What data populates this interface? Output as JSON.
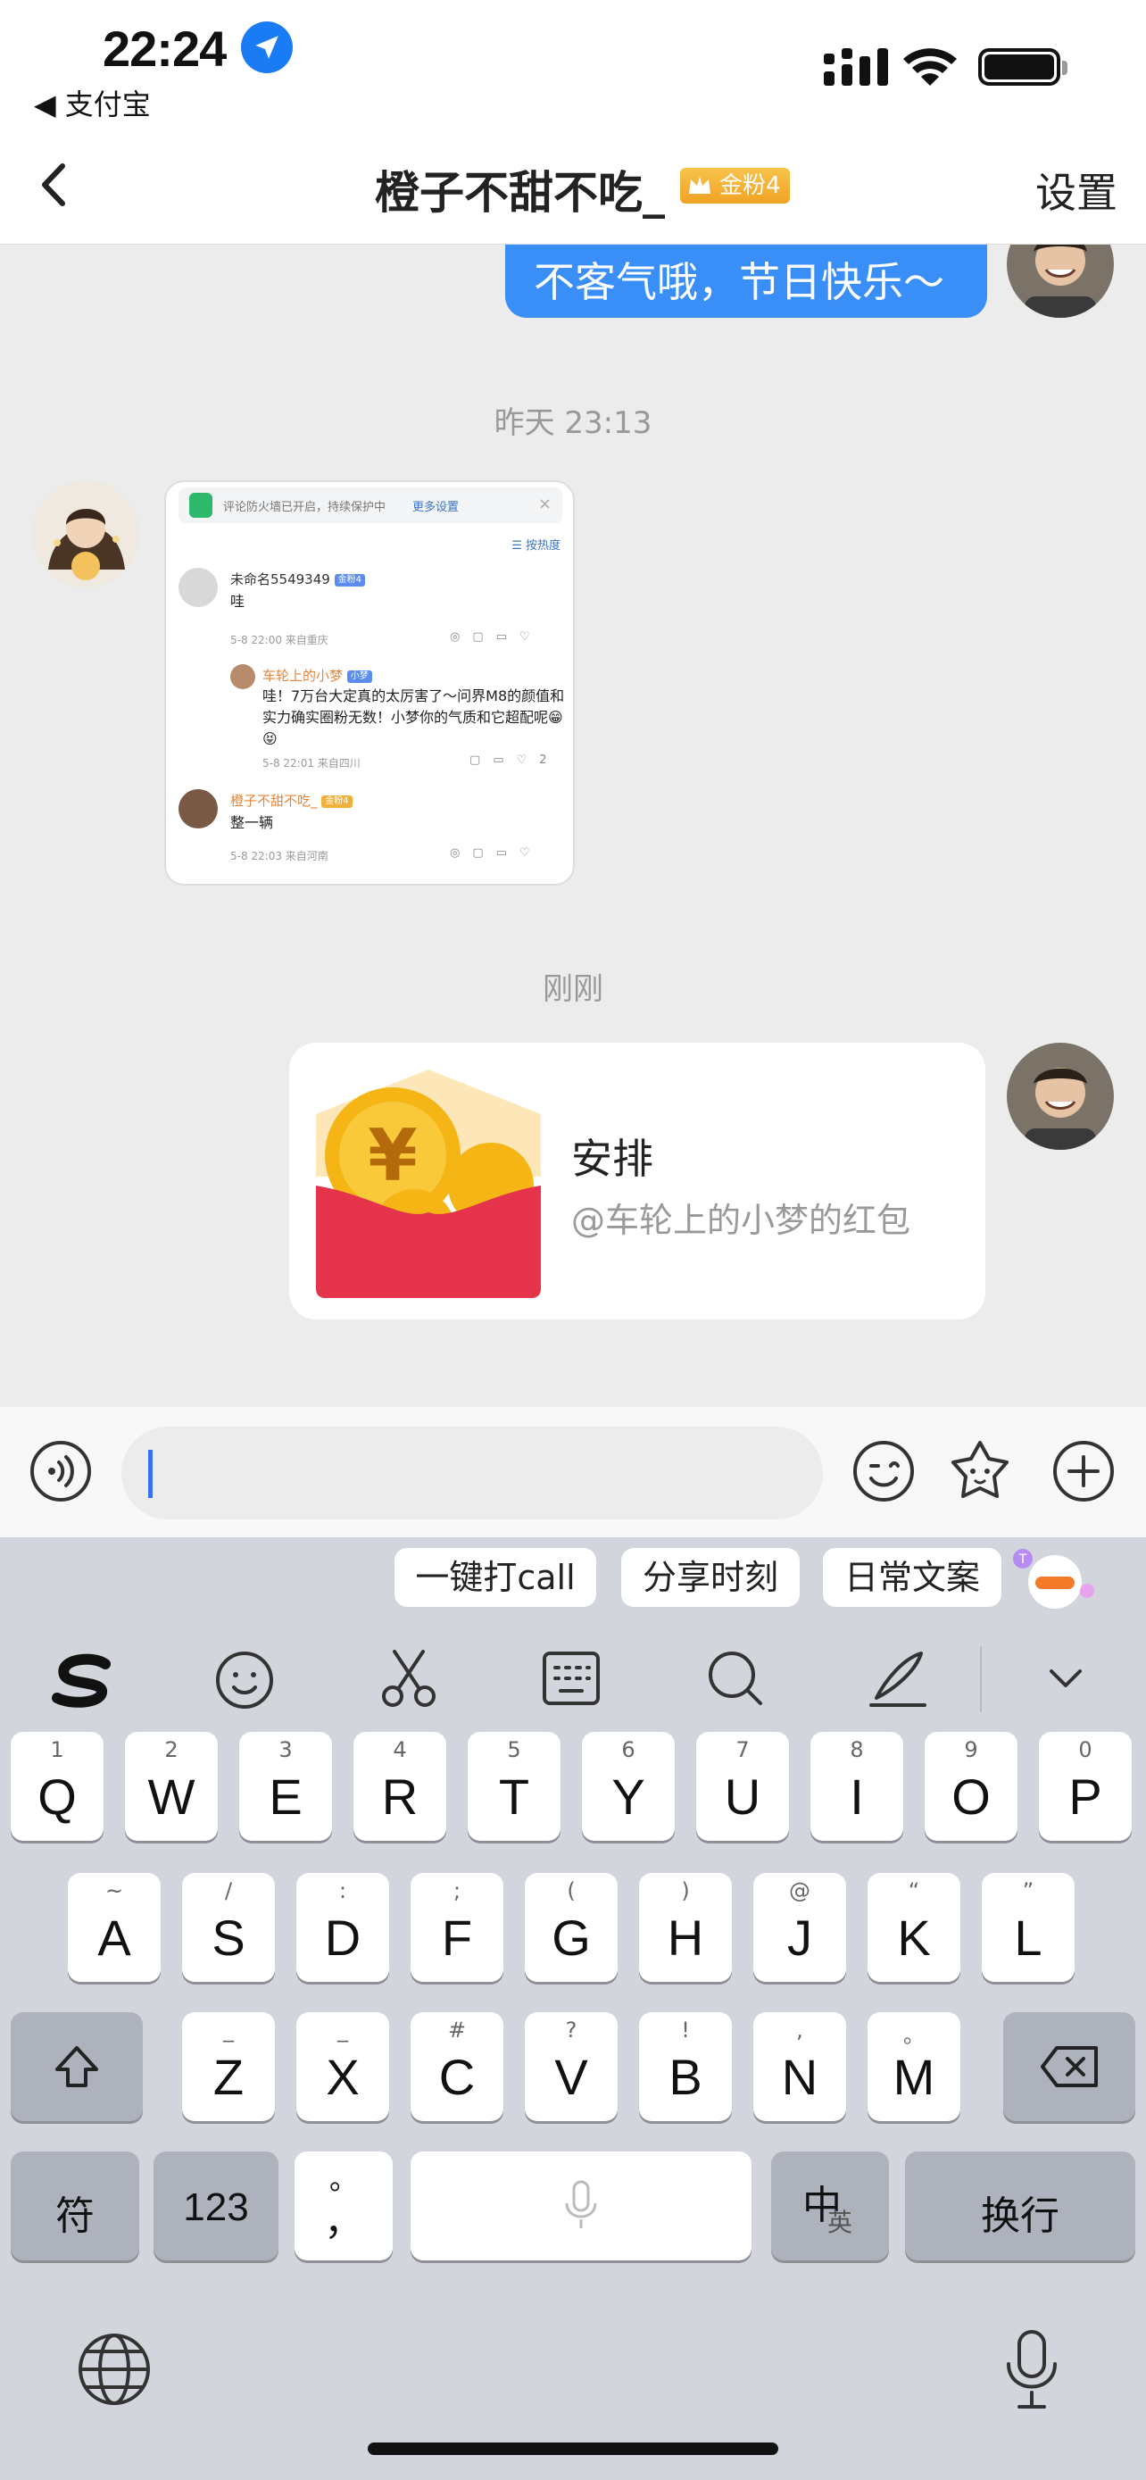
{
  "status_bar": {
    "time": "22:24",
    "back_app": "◀ 支付宝"
  },
  "nav": {
    "title": "橙子不甜不吃_",
    "badge": "金粉4",
    "settings": "设置"
  },
  "chat": {
    "prev_message": "不客气哦，节日快乐～",
    "timestamp_1": "昨天 23:13",
    "timestamp_2": "刚刚",
    "screenshot": {
      "banner_text": "评论防火墙已开启，持续保护中",
      "banner_more": "更多设置",
      "sort_label": "按热度",
      "c1_name": "未命名5549349",
      "c1_badge": "金粉4",
      "c1_text": "哇",
      "c1_meta": "5-8 22:00 来自重庆",
      "c2_name": "车轮上的小梦",
      "c2_badge": "小梦",
      "c2_text": "哇！7万台大定真的太厉害了～问界M8的颜值和实力确实圈粉无数！小梦你的气质和它超配呢😁😝",
      "c2_meta": "5-8 22:01 来自四川",
      "c2_likes": "2",
      "c3_name": "橙子不甜不吃_",
      "c3_badge": "金粉4",
      "c3_text": "整一辆",
      "c3_meta": "5-8 22:03 来自河南"
    },
    "red_packet": {
      "label": "安排",
      "sub": "@车轮上的小梦的红包"
    }
  },
  "keyboard": {
    "chips": [
      "一键打call",
      "分享时刻",
      "日常文案"
    ],
    "row1": [
      {
        "k": "Q",
        "h": "1"
      },
      {
        "k": "W",
        "h": "2"
      },
      {
        "k": "E",
        "h": "3"
      },
      {
        "k": "R",
        "h": "4"
      },
      {
        "k": "T",
        "h": "5"
      },
      {
        "k": "Y",
        "h": "6"
      },
      {
        "k": "U",
        "h": "7"
      },
      {
        "k": "I",
        "h": "8"
      },
      {
        "k": "O",
        "h": "9"
      },
      {
        "k": "P",
        "h": "0"
      }
    ],
    "row2": [
      {
        "k": "A",
        "h": "~"
      },
      {
        "k": "S",
        "h": "/"
      },
      {
        "k": "D",
        "h": ":"
      },
      {
        "k": "F",
        "h": ";"
      },
      {
        "k": "G",
        "h": "("
      },
      {
        "k": "H",
        "h": ")"
      },
      {
        "k": "J",
        "h": "@"
      },
      {
        "k": "K",
        "h": "“"
      },
      {
        "k": "L",
        "h": "”"
      }
    ],
    "row3": [
      {
        "k": "Z",
        "h": "_"
      },
      {
        "k": "X",
        "h": "_"
      },
      {
        "k": "C",
        "h": "#"
      },
      {
        "k": "V",
        "h": "?"
      },
      {
        "k": "B",
        "h": "!"
      },
      {
        "k": "N",
        "h": ","
      },
      {
        "k": "M",
        "h": "。"
      }
    ],
    "symbols_key": "符",
    "numbers_key": "123",
    "punct_key_top": "。",
    "punct_key_bottom": "，",
    "lang_key_main": "中",
    "lang_key_alt": "英",
    "enter_key": "换行"
  },
  "colors": {
    "accent_blue": "#3a8ef7",
    "red_packet": "#e4334b",
    "badge_gold": "#f0a325"
  }
}
